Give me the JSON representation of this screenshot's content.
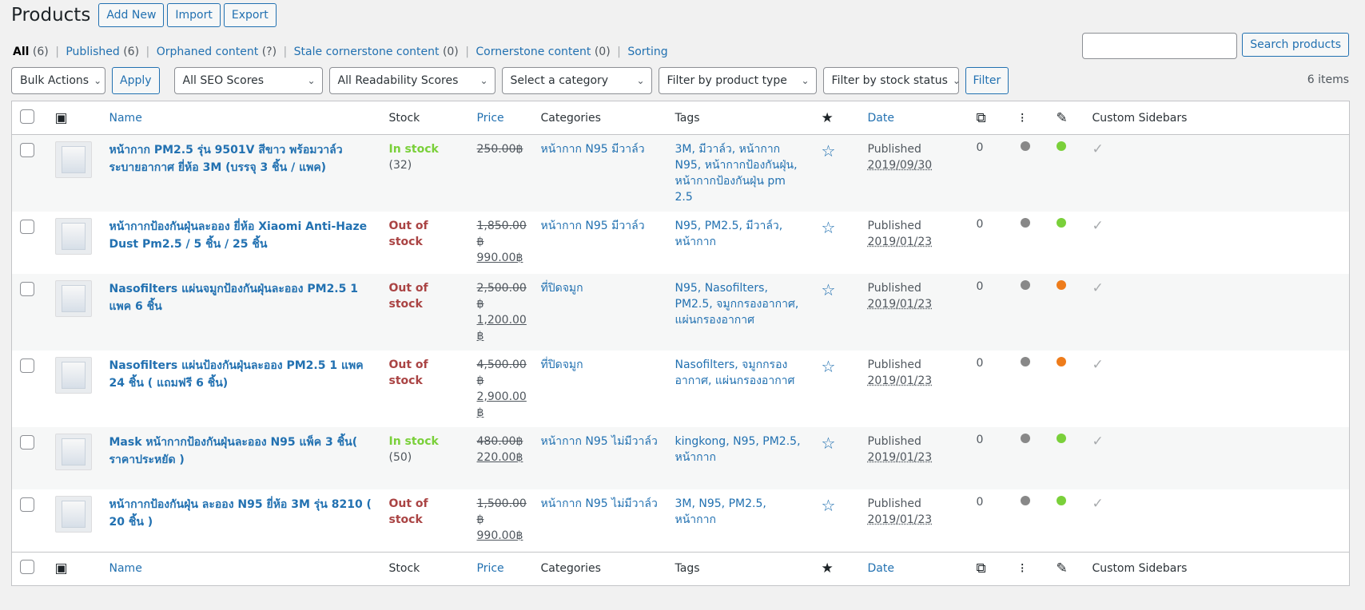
{
  "page": {
    "title": "Products",
    "add_new": "Add New",
    "import": "Import",
    "export": "Export"
  },
  "views": {
    "all": "All",
    "all_count": "(6)",
    "published": "Published",
    "published_count": "(6)",
    "orphaned": "Orphaned content",
    "orphaned_count": "(?)",
    "stale": "Stale cornerstone content",
    "stale_count": "(0)",
    "cornerstone": "Cornerstone content",
    "cornerstone_count": "(0)",
    "sorting": "Sorting",
    "separator": "|"
  },
  "search": {
    "value": "",
    "button": "Search products"
  },
  "filters": {
    "bulk_actions": "Bulk Actions",
    "apply": "Apply",
    "seo_scores": "All SEO Scores",
    "readability": "All Readability Scores",
    "category": "Select a category",
    "product_type": "Filter by product type",
    "stock_status": "Filter by stock status",
    "filter": "Filter",
    "items_count": "6 items"
  },
  "columns": {
    "name": "Name",
    "stock": "Stock",
    "price": "Price",
    "categories": "Categories",
    "tags": "Tags",
    "date": "Date",
    "custom_sidebars": "Custom Sidebars"
  },
  "colors": {
    "link": "#2271b1",
    "in_stock": "#7ad03a",
    "out_of_stock": "#aa4444",
    "dot_gray": "#888888",
    "dot_green": "#7ad03a",
    "dot_orange": "#ee7c1b"
  },
  "products": [
    {
      "name": "หน้ากาก PM2.5 รุ่น 9501V สีขาว พร้อมวาล์วระบายอากาศ ยี่ห้อ 3M (บรรจุ 3 ชิ้น / แพค)",
      "stock_label": "In stock",
      "stock_qty": "(32)",
      "price_regular": "250.00฿",
      "price_sale": "",
      "categories": "หน้ากาก N95 มีวาล์ว",
      "tags": "3M, มีวาล์ว, หน้ากาก N95, หน้ากากป้องกันฝุ่น, หน้ากากป้องกันฝุ่น pm 2.5",
      "links": "0",
      "date_status": "Published",
      "date_value": "2019/09/30",
      "seo": "gray",
      "readability": "green"
    },
    {
      "name": "หน้ากากป้องกันฝุ่นละออง ยี่ห้อ Xiaomi Anti-Haze Dust Pm2.5 / 5 ชิ้น / 25 ชิ้น",
      "stock_label": "Out of stock",
      "stock_qty": "",
      "price_regular": "1,850.00 ฿",
      "price_sale": "990.00฿",
      "categories": "หน้ากาก N95 มีวาล์ว",
      "tags": "N95, PM2.5, มีวาล์ว, หน้ากาก",
      "links": "0",
      "date_status": "Published",
      "date_value": "2019/01/23",
      "seo": "gray",
      "readability": "green"
    },
    {
      "name": "Nasofilters แผ่นจมูกป้องกันฝุ่นละออง PM2.5 1 แพค 6 ชิ้น",
      "stock_label": "Out of stock",
      "stock_qty": "",
      "price_regular": "2,500.00 ฿",
      "price_sale": "1,200.00 ฿",
      "categories": "ที่ปิดจมูก",
      "tags": "N95, Nasofilters, PM2.5, จมูกกรองอากาศ, แผ่นกรองอากาศ",
      "links": "0",
      "date_status": "Published",
      "date_value": "2019/01/23",
      "seo": "gray",
      "readability": "orange"
    },
    {
      "name": "Nasofilters แผ่นป้องกันฝุ่นละออง PM2.5 1 แพค 24 ชิ้น ( แถมฟรี 6 ชิ้น)",
      "stock_label": "Out of stock",
      "stock_qty": "",
      "price_regular": "4,500.00 ฿",
      "price_sale": "2,900.00 ฿",
      "categories": "ที่ปิดจมูก",
      "tags": "Nasofilters, จมูกกรองอากาศ, แผ่นกรองอากาศ",
      "links": "0",
      "date_status": "Published",
      "date_value": "2019/01/23",
      "seo": "gray",
      "readability": "orange"
    },
    {
      "name": "Mask หน้ากากป้องกันฝุ่นละออง N95 แพ็ค 3 ชิ้น( ราคาประหยัด )",
      "stock_label": "In stock",
      "stock_qty": "(50)",
      "price_regular": "480.00฿",
      "price_sale": "220.00฿",
      "categories": "หน้ากาก N95 ไม่มีวาล์ว",
      "tags": "kingkong, N95, PM2.5, หน้ากาก",
      "links": "0",
      "date_status": "Published",
      "date_value": "2019/01/23",
      "seo": "gray",
      "readability": "green"
    },
    {
      "name": "หน้ากากป้องกันฝุ่น ละออง N95 ยี่ห้อ 3M รุ่น 8210 ( 20 ชิ้น )",
      "stock_label": "Out of stock",
      "stock_qty": "",
      "price_regular": "1,500.00 ฿",
      "price_sale": "990.00฿",
      "categories": "หน้ากาก N95 ไม่มีวาล์ว",
      "tags": "3M, N95, PM2.5, หน้ากาก",
      "links": "0",
      "date_status": "Published",
      "date_value": "2019/01/23",
      "seo": "gray",
      "readability": "green"
    }
  ],
  "icons": {
    "image_column": "image-icon",
    "featured_column": "star-filled-icon",
    "links_column": "internal-links-icon",
    "seo_column": "traffic-light-icon",
    "readability_column": "feather-icon",
    "featured_row": "star-outline-icon",
    "sidebars_row": "checkmark-icon",
    "select_chevron": "chevron-down-icon"
  }
}
